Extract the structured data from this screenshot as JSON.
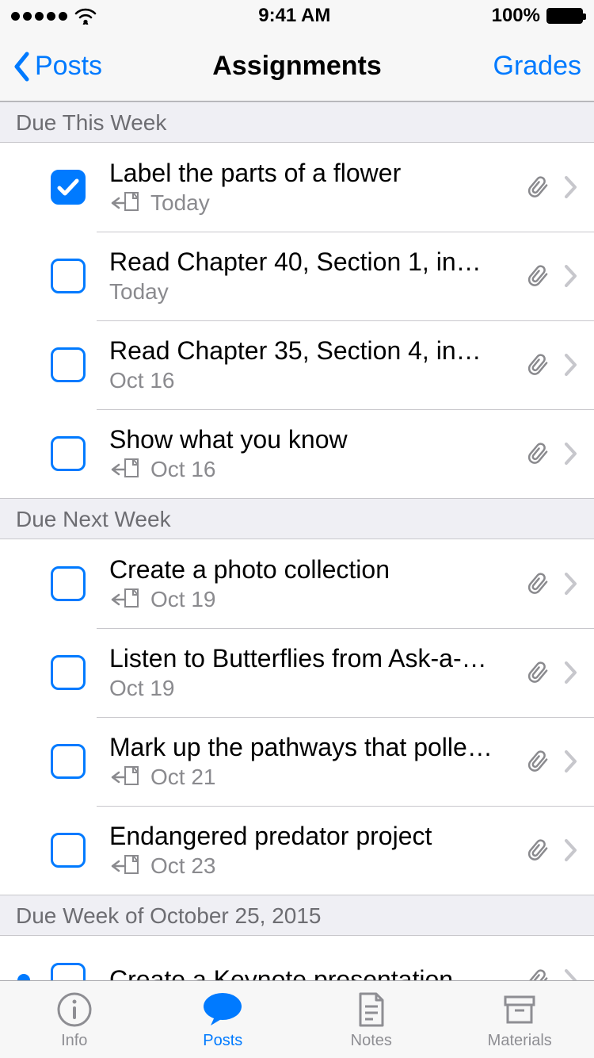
{
  "status": {
    "time": "9:41 AM",
    "battery_text": "100%"
  },
  "nav": {
    "back_label": "Posts",
    "title": "Assignments",
    "right_label": "Grades"
  },
  "sections": [
    {
      "header": "Due This Week",
      "items": [
        {
          "checked": true,
          "title": "Label the parts of a flower",
          "sub": "Today",
          "handin": true,
          "attachment": true,
          "unread": false
        },
        {
          "checked": false,
          "title": "Read Chapter 40, Section 1, in…",
          "sub": "Today",
          "handin": false,
          "attachment": true,
          "unread": false
        },
        {
          "checked": false,
          "title": "Read Chapter 35, Section 4, in…",
          "sub": "Oct 16",
          "handin": false,
          "attachment": true,
          "unread": false
        },
        {
          "checked": false,
          "title": "Show what you know",
          "sub": "Oct 16",
          "handin": true,
          "attachment": true,
          "unread": false
        }
      ]
    },
    {
      "header": "Due Next Week",
      "items": [
        {
          "checked": false,
          "title": "Create a photo collection",
          "sub": "Oct 19",
          "handin": true,
          "attachment": true,
          "unread": false
        },
        {
          "checked": false,
          "title": "Listen to Butterflies from Ask-a-…",
          "sub": "Oct 19",
          "handin": false,
          "attachment": true,
          "unread": false
        },
        {
          "checked": false,
          "title": "Mark up the pathways that polle…",
          "sub": "Oct 21",
          "handin": true,
          "attachment": true,
          "unread": false
        },
        {
          "checked": false,
          "title": "Endangered predator project",
          "sub": "Oct 23",
          "handin": true,
          "attachment": true,
          "unread": false
        }
      ]
    },
    {
      "header": "Due Week of October 25, 2015",
      "items": [
        {
          "checked": false,
          "title": "Create a Keynote presentation…",
          "sub": "",
          "handin": false,
          "attachment": true,
          "unread": true
        }
      ]
    }
  ],
  "tabs": [
    {
      "id": "info",
      "label": "Info",
      "icon": "info-circle-icon",
      "active": false
    },
    {
      "id": "posts",
      "label": "Posts",
      "icon": "chat-bubble-icon",
      "active": true
    },
    {
      "id": "notes",
      "label": "Notes",
      "icon": "note-page-icon",
      "active": false
    },
    {
      "id": "materials",
      "label": "Materials",
      "icon": "box-icon",
      "active": false
    }
  ]
}
